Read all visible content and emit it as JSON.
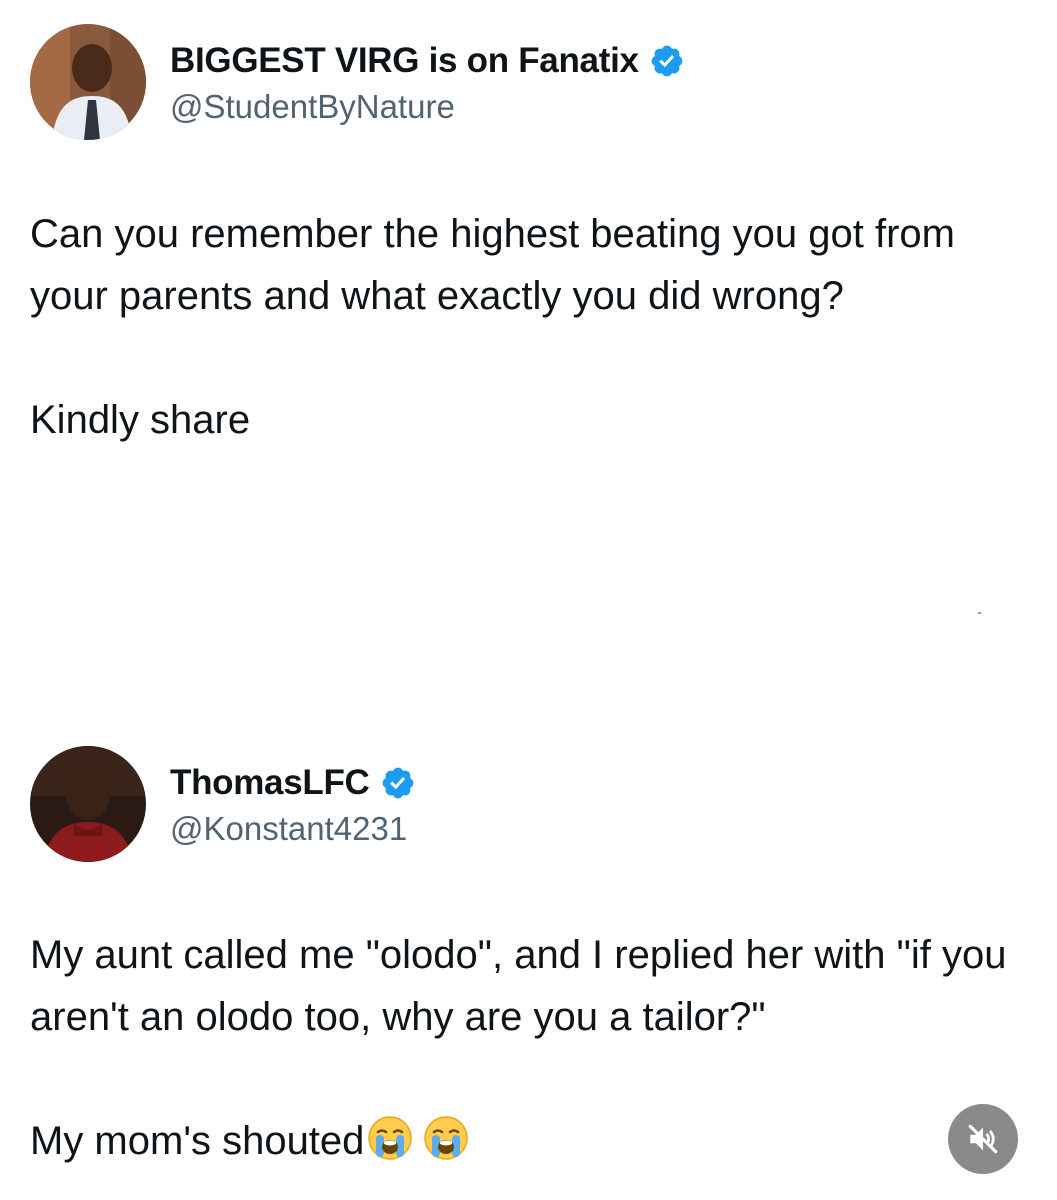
{
  "tweets": [
    {
      "author": {
        "display_name": "BIGGEST VIRG is on Fanatix",
        "handle": "@StudentByNature",
        "verified": true,
        "avatar_icon": "avatar-photo"
      },
      "body": {
        "line_1": "Can you remember the highest beating you got from your parents and what exactly you did wrong?",
        "line_2": "Kindly share"
      }
    },
    {
      "author": {
        "display_name": "ThomasLFC",
        "handle": "@Konstant4231",
        "verified": true,
        "avatar_icon": "avatar-photo"
      },
      "body": {
        "line_1": "My aunt called me \"olodo\", and I replied her with \"if you aren't an olodo too, why are you a tailor?\"",
        "line_2": "My mom's shouted",
        "emojis": [
          "loudly-crying-face-icon",
          "loudly-crying-face-icon"
        ]
      }
    }
  ],
  "controls": {
    "mute_icon": "speaker-muted-icon"
  },
  "colors": {
    "verified_badge": "#1d9bf0",
    "handle_text": "#536471",
    "body_text": "#0f1419",
    "mute_button_bg": "#8a8a8a"
  }
}
